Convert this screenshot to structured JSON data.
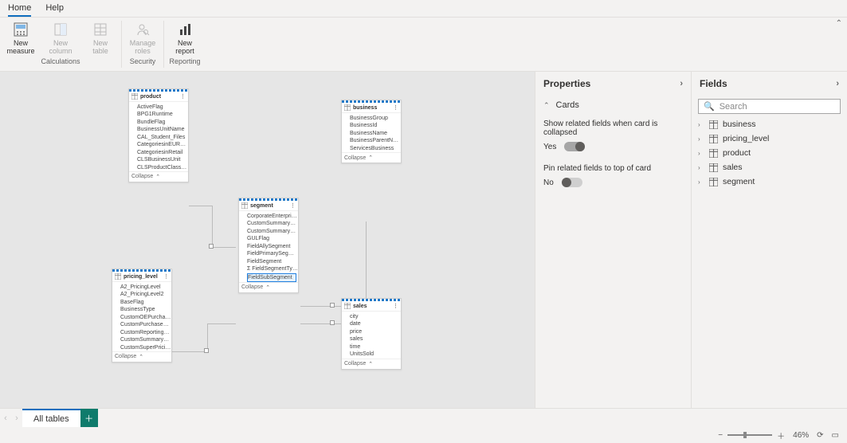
{
  "tabs": {
    "home": "Home",
    "help": "Help"
  },
  "ribbon": {
    "new_measure": "New\nmeasure",
    "new_column": "New\ncolumn",
    "new_table": "New\ntable",
    "manage_roles": "Manage\nroles",
    "new_report": "New\nreport",
    "grp_calc": "Calculations",
    "grp_sec": "Security",
    "grp_rep": "Reporting"
  },
  "cards": {
    "product": {
      "title": "product",
      "fields": [
        "ActiveFlag",
        "BPG1Runtime",
        "BundleFlag",
        "BusinessUnitName",
        "CAL_Student_Files",
        "CategoriesinEURField",
        "CategoriesinRetail",
        "CLSBusinessUnit",
        "CLSProductClassesAndServices"
      ],
      "collapse": "Collapse"
    },
    "business": {
      "title": "business",
      "fields": [
        "BusinessGroup",
        "BusinessId",
        "BusinessName",
        "BusinessParentName",
        "ServicesBusiness"
      ],
      "collapse": "Collapse"
    },
    "segment": {
      "title": "segment",
      "fields": [
        "CorporateEnterpriseFlag",
        "CustomSummaryUlpacted",
        "CustomSummarySegment",
        "GULFlag",
        "FieldAllySegment",
        "FieldPrimarySegment",
        "FieldSegment",
        "FieldSegmentTypd",
        "FieldSubSegment"
      ],
      "collapse": "Collapse"
    },
    "pricing_level": {
      "title": "pricing_level",
      "fields": [
        "A2_PricingLevel",
        "A2_PricingLevel2",
        "BaseFlag",
        "BusinessType",
        "CustomOEPurchaseType",
        "CustomPurchaseType",
        "CustomReportingSummaryPurc...",
        "CustomSummaryPurchaseType",
        "CustomSuperPricingLevel"
      ],
      "collapse": "Collapse"
    },
    "sales": {
      "title": "sales",
      "fields": [
        "city",
        "date",
        "price",
        "sales",
        "time",
        "UnitsSold"
      ],
      "collapse": "Collapse"
    }
  },
  "properties": {
    "title": "Properties",
    "cards_section": "Cards",
    "related_label": "Show related fields when card is collapsed",
    "related_value": "Yes",
    "pin_label": "Pin related fields to top of card",
    "pin_value": "No"
  },
  "fields": {
    "title": "Fields",
    "search_placeholder": "Search",
    "items": [
      "business",
      "pricing_level",
      "product",
      "sales",
      "segment"
    ]
  },
  "bottom": {
    "tab": "All tables"
  },
  "status": {
    "zoom": "46%"
  },
  "chart_data": {
    "type": "diagram",
    "tables": [
      "product",
      "business",
      "segment",
      "pricing_level",
      "sales"
    ],
    "relationships": [
      [
        "product",
        "segment"
      ],
      [
        "business",
        "segment"
      ],
      [
        "pricing_level",
        "segment"
      ],
      [
        "sales",
        "segment"
      ]
    ]
  }
}
